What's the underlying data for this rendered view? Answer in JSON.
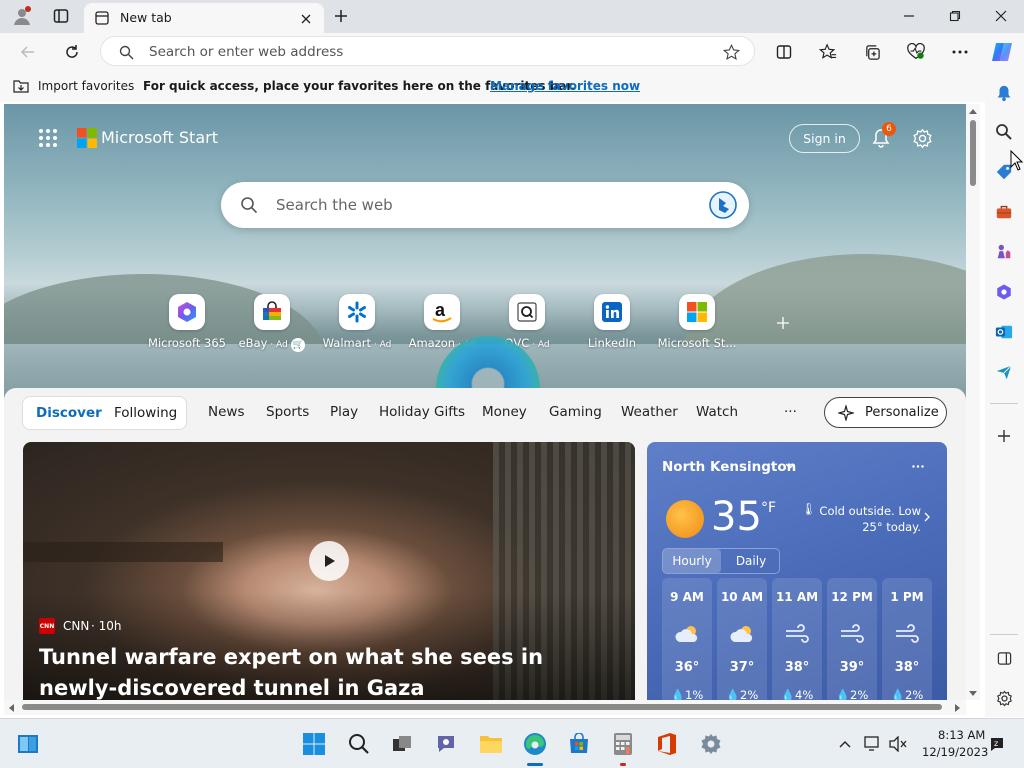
{
  "browser": {
    "tab_title": "New tab",
    "address_placeholder": "Search or enter web address"
  },
  "favorites_bar": {
    "import_label": "Import favorites",
    "message": "For quick access, place your favorites here on the favorites bar.",
    "manage_link": "Manage favorites now"
  },
  "header": {
    "brand": "Microsoft Start",
    "sign_in": "Sign in",
    "notification_count": "6",
    "search_placeholder": "Search the web"
  },
  "quick_links": [
    {
      "label": "Microsoft 365",
      "ad": ""
    },
    {
      "label": "eBay",
      "ad": " · Ad"
    },
    {
      "label": "Walmart",
      "ad": " · Ad"
    },
    {
      "label": "Amazon",
      "ad": " · Ad"
    },
    {
      "label": "QVC",
      "ad": " · Ad"
    },
    {
      "label": "LinkedIn",
      "ad": ""
    },
    {
      "label": "Microsoft St...",
      "ad": ""
    }
  ],
  "feed_nav": {
    "tabs": [
      "Discover",
      "Following"
    ],
    "categories": [
      "News",
      "Sports",
      "Play",
      "Holiday Gifts",
      "Money",
      "Gaming",
      "Weather",
      "Watch"
    ],
    "more": "···",
    "personalize": "Personalize"
  },
  "story": {
    "source": "CNN",
    "age": " · 10h",
    "headline": "Tunnel warfare expert on what she sees in newly-discovered tunnel in Gaza"
  },
  "weather": {
    "location": "North Kensington",
    "temperature": "35",
    "unit": "°F",
    "note": "Cold outside. Low 25° today.",
    "tabs": [
      "Hourly",
      "Daily"
    ],
    "hours": [
      {
        "time": "9 AM",
        "icon": "cloudy-icon",
        "temp": "36°",
        "precip": "1%"
      },
      {
        "time": "10 AM",
        "icon": "cloudy-icon",
        "temp": "37°",
        "precip": "2%"
      },
      {
        "time": "11 AM",
        "icon": "windy-icon",
        "temp": "38°",
        "precip": "4%"
      },
      {
        "time": "12 PM",
        "icon": "windy-icon",
        "temp": "39°",
        "precip": "2%"
      },
      {
        "time": "1 PM",
        "icon": "windy-icon",
        "temp": "38°",
        "precip": "2%"
      }
    ]
  },
  "taskbar": {
    "time": "8:13 AM",
    "date": "12/19/2023"
  },
  "colors": {
    "accent": "#0f6cbd",
    "weather_bg": "#4a6bb8",
    "notification_badge": "#e8590c"
  }
}
